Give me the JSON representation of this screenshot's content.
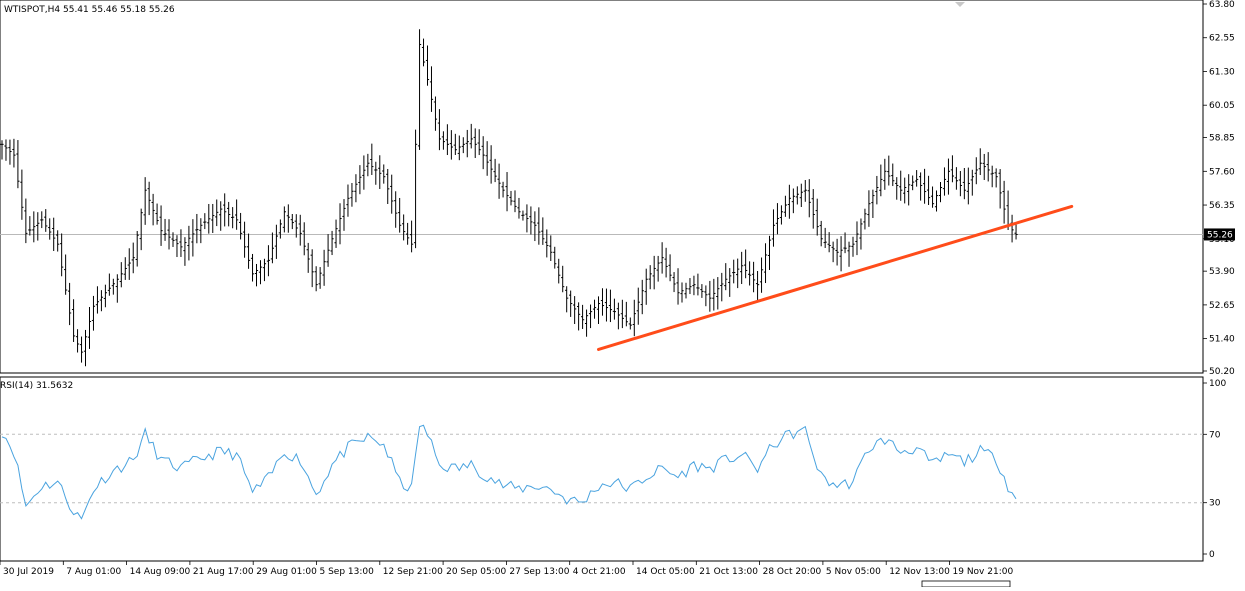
{
  "chart_data": [
    {
      "type": "candlestick",
      "symbol_header": "WTISPOT,H4  55.41 55.46 55.18 55.26",
      "current_price_label": "55.26",
      "y_ticks": [
        "63.80",
        "62.55",
        "61.30",
        "60.05",
        "58.85",
        "57.60",
        "56.35",
        "55.10",
        "53.90",
        "52.65",
        "51.40",
        "50.20"
      ],
      "ylim": [
        50.2,
        63.8
      ],
      "x_ticks": [
        "30 Jul 2019",
        "7 Aug 01:00",
        "14 Aug 09:00",
        "21 Aug 17:00",
        "29 Aug 01:00",
        "5 Sep 13:00",
        "12 Sep 21:00",
        "20 Sep 05:00",
        "27 Sep 13:00",
        "4 Oct 21:00",
        "14 Oct 05:00",
        "21 Oct 13:00",
        "28 Oct 20:00",
        "5 Nov 05:00",
        "12 Nov 13:00",
        "19 Nov 21:00"
      ],
      "price_anchors": [
        [
          0,
          58.6
        ],
        [
          3,
          58.2
        ],
        [
          6,
          55.3
        ],
        [
          10,
          55.8
        ],
        [
          14,
          54.9
        ],
        [
          18,
          51.5
        ],
        [
          20,
          50.9
        ],
        [
          23,
          52.6
        ],
        [
          26,
          53.1
        ],
        [
          29,
          53.6
        ],
        [
          33,
          54.4
        ],
        [
          36,
          56.9
        ],
        [
          40,
          55.4
        ],
        [
          45,
          54.8
        ],
        [
          50,
          55.6
        ],
        [
          55,
          56.2
        ],
        [
          59,
          55.8
        ],
        [
          63,
          53.8
        ],
        [
          67,
          54.3
        ],
        [
          71,
          56.1
        ],
        [
          75,
          55.3
        ],
        [
          79,
          53.4
        ],
        [
          83,
          55.1
        ],
        [
          87,
          56.6
        ],
        [
          92,
          57.9
        ],
        [
          96,
          57.4
        ],
        [
          100,
          55.6
        ],
        [
          103,
          54.9
        ],
        [
          105,
          62.3
        ],
        [
          107,
          61.0
        ],
        [
          110,
          58.8
        ],
        [
          114,
          58.4
        ],
        [
          118,
          58.8
        ],
        [
          121,
          58.2
        ],
        [
          126,
          56.9
        ],
        [
          130,
          56.1
        ],
        [
          134,
          55.6
        ],
        [
          138,
          54.6
        ],
        [
          142,
          52.9
        ],
        [
          146,
          52.1
        ],
        [
          150,
          52.7
        ],
        [
          154,
          52.4
        ],
        [
          158,
          51.9
        ],
        [
          162,
          53.6
        ],
        [
          166,
          54.4
        ],
        [
          170,
          53.1
        ],
        [
          174,
          53.4
        ],
        [
          178,
          52.9
        ],
        [
          182,
          53.6
        ],
        [
          186,
          54.1
        ],
        [
          190,
          53.4
        ],
        [
          194,
          55.6
        ],
        [
          198,
          56.6
        ],
        [
          202,
          56.9
        ],
        [
          206,
          55.1
        ],
        [
          210,
          54.6
        ],
        [
          214,
          54.9
        ],
        [
          218,
          56.4
        ],
        [
          222,
          57.6
        ],
        [
          226,
          56.9
        ],
        [
          230,
          57.3
        ],
        [
          234,
          56.4
        ],
        [
          238,
          57.6
        ],
        [
          242,
          56.9
        ],
        [
          246,
          57.9
        ],
        [
          250,
          57.4
        ],
        [
          253,
          55.6
        ],
        [
          255,
          55.26
        ]
      ],
      "candle_count": 256,
      "trendline": {
        "from": [
          150,
          51.0
        ],
        "to": [
          269,
          56.3
        ],
        "color": "#ff4c1a"
      }
    },
    {
      "type": "line",
      "indicator_header": "RSI(14) 31.5632",
      "ylim": [
        0,
        100
      ],
      "y_ticks": [
        "100",
        "70",
        "30",
        "0"
      ],
      "levels": [
        70,
        30
      ],
      "series_color": "#4aa3df",
      "rsi_anchors": [
        [
          0,
          72
        ],
        [
          3,
          60
        ],
        [
          6,
          28
        ],
        [
          10,
          40
        ],
        [
          14,
          42
        ],
        [
          18,
          25
        ],
        [
          20,
          20
        ],
        [
          23,
          38
        ],
        [
          26,
          45
        ],
        [
          29,
          50
        ],
        [
          33,
          55
        ],
        [
          36,
          70
        ],
        [
          40,
          55
        ],
        [
          45,
          50
        ],
        [
          50,
          56
        ],
        [
          55,
          60
        ],
        [
          59,
          58
        ],
        [
          63,
          36
        ],
        [
          67,
          44
        ],
        [
          71,
          60
        ],
        [
          75,
          55
        ],
        [
          79,
          35
        ],
        [
          83,
          52
        ],
        [
          87,
          62
        ],
        [
          92,
          68
        ],
        [
          96,
          64
        ],
        [
          100,
          42
        ],
        [
          103,
          38
        ],
        [
          105,
          76
        ],
        [
          107,
          70
        ],
        [
          110,
          52
        ],
        [
          114,
          50
        ],
        [
          118,
          52
        ],
        [
          121,
          47
        ],
        [
          126,
          40
        ],
        [
          130,
          38
        ],
        [
          134,
          40
        ],
        [
          138,
          38
        ],
        [
          142,
          32
        ],
        [
          146,
          30
        ],
        [
          150,
          40
        ],
        [
          154,
          42
        ],
        [
          158,
          38
        ],
        [
          162,
          45
        ],
        [
          166,
          50
        ],
        [
          170,
          45
        ],
        [
          174,
          52
        ],
        [
          178,
          50
        ],
        [
          182,
          55
        ],
        [
          186,
          58
        ],
        [
          190,
          50
        ],
        [
          194,
          64
        ],
        [
          198,
          70
        ],
        [
          202,
          72
        ],
        [
          206,
          45
        ],
        [
          210,
          40
        ],
        [
          214,
          42
        ],
        [
          218,
          62
        ],
        [
          222,
          67
        ],
        [
          226,
          60
        ],
        [
          230,
          62
        ],
        [
          234,
          52
        ],
        [
          238,
          58
        ],
        [
          242,
          54
        ],
        [
          246,
          60
        ],
        [
          250,
          56
        ],
        [
          253,
          40
        ],
        [
          255,
          31.6
        ]
      ]
    }
  ]
}
